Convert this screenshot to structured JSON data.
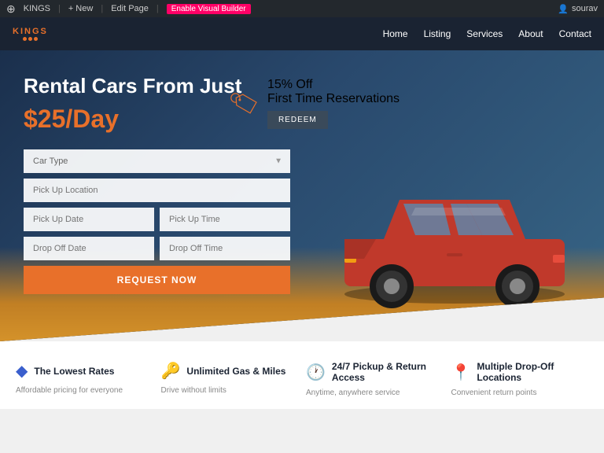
{
  "adminBar": {
    "wpLogo": "⚙",
    "siteName": "KINGS",
    "newLabel": "+ New",
    "editPageLabel": "Edit Page",
    "enableVisualLabel": "Enable Visual Builder",
    "userLabel": "sourav"
  },
  "nav": {
    "logoText": "KINGS",
    "links": [
      {
        "label": "Home"
      },
      {
        "label": "Listing"
      },
      {
        "label": "Services"
      },
      {
        "label": "About"
      },
      {
        "label": "Contact"
      }
    ]
  },
  "hero": {
    "title": "Rental Cars From Just",
    "price": "$25/Day",
    "promo": {
      "off": "15% Off",
      "subtitle": "First Time Reservations",
      "redeemLabel": "REDEEM"
    },
    "form": {
      "carTypePlaceholder": "Car Type",
      "pickUpLocationPlaceholder": "Pick Up Location",
      "pickUpDatePlaceholder": "Pick Up Date",
      "pickUpTimePlaceholder": "Pick Up Time",
      "dropOffDatePlaceholder": "Drop Off Date",
      "dropOffTimePlaceholder": "Drop Off Time",
      "requestButtonLabel": "REQUEST NOW"
    }
  },
  "features": [
    {
      "icon": "◆",
      "iconColor": "#3a5fcd",
      "title": "The Lowest Rates",
      "desc": "Affordable pricing for everyone"
    },
    {
      "icon": "🔑",
      "iconColor": "#e8702a",
      "title": "Unlimited Gas & Miles",
      "desc": "Drive without limits"
    },
    {
      "icon": "🕐",
      "iconColor": "#3a5fcd",
      "title": "24/7 Pickup & Return Access",
      "desc": "Anytime, anywhere service"
    },
    {
      "icon": "📍",
      "iconColor": "#3a5fcd",
      "title": "Multiple Drop-Off Locations",
      "desc": "Convenient return points"
    }
  ]
}
